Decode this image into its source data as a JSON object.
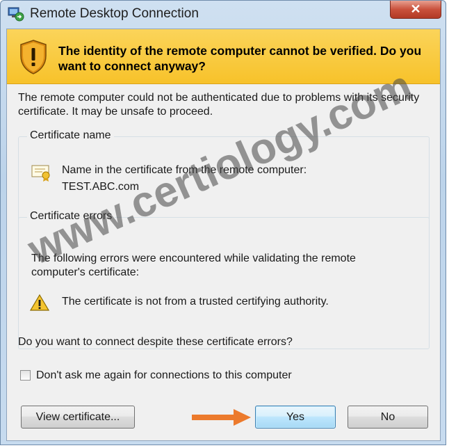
{
  "window": {
    "title": "Remote Desktop Connection",
    "close_label": "✕"
  },
  "banner": {
    "text": "The identity of the remote computer cannot be verified. Do you want to connect anyway?"
  },
  "intro": "The remote computer could not be authenticated due to problems with its security certificate. It may be unsafe to proceed.",
  "certificate_name": {
    "label": "Certificate name",
    "line1": "Name in the certificate from the remote computer:",
    "value": "TEST.ABC.com"
  },
  "certificate_errors": {
    "label": "Certificate errors",
    "intro": "The following errors were encountered while validating the remote computer's certificate:",
    "items": [
      "The certificate is not from a trusted certifying authority."
    ]
  },
  "question": "Do you want to connect despite these certificate errors?",
  "checkbox": {
    "label": "Don't ask me again for connections to this computer",
    "checked": false
  },
  "buttons": {
    "view": "View certificate...",
    "yes": "Yes",
    "no": "No"
  },
  "watermark": "www.certiology.com",
  "colors": {
    "banner": "#f7c22a",
    "arrow": "#ec7a2c",
    "close": "#c9513c"
  },
  "icons": {
    "app": "remote-desktop-icon",
    "banner": "warning-shield-icon",
    "cert": "certificate-icon",
    "error": "warning-triangle-icon",
    "arrow": "arrow-right-icon"
  }
}
